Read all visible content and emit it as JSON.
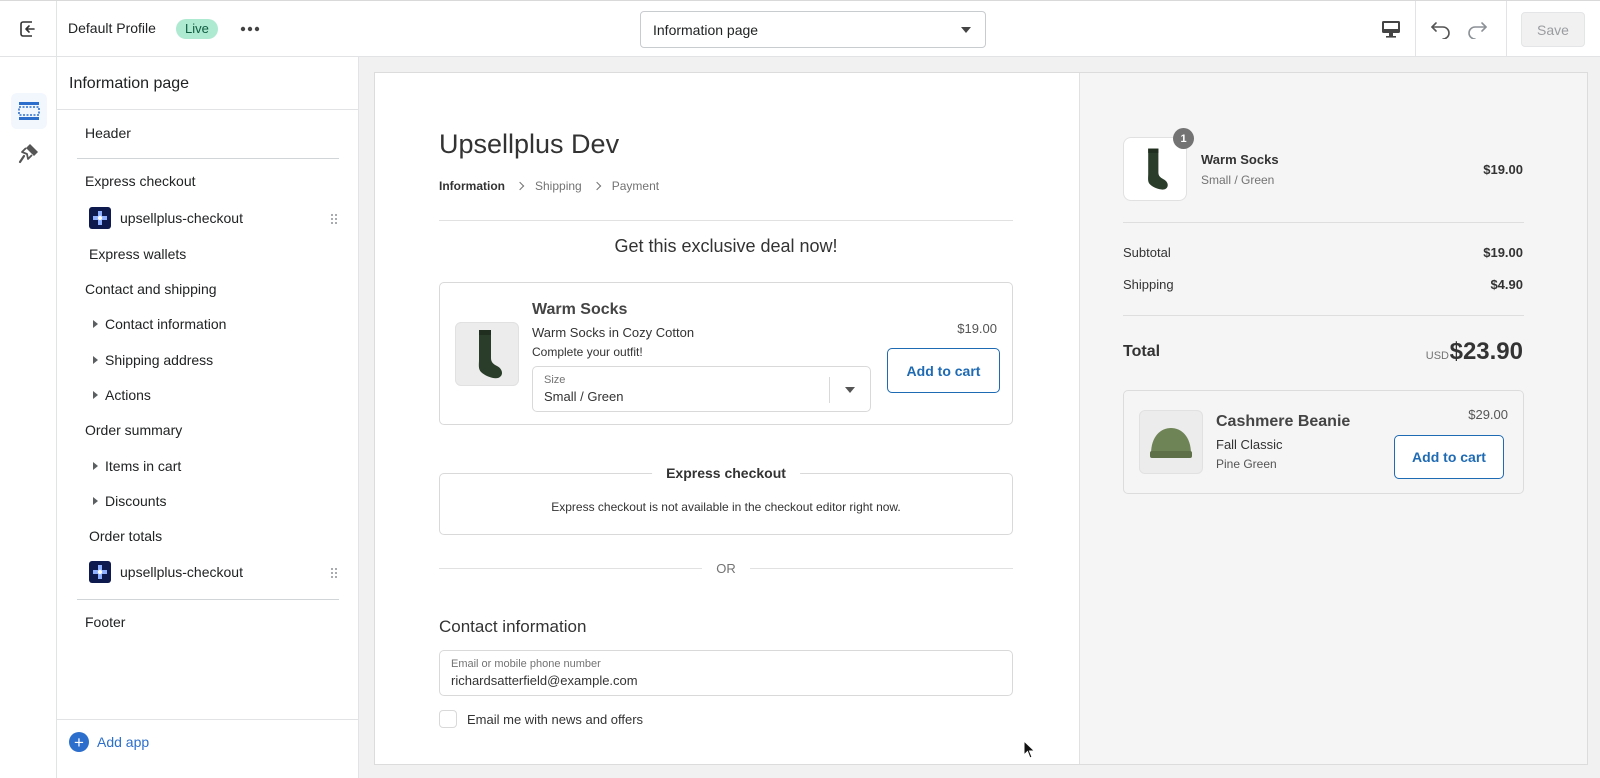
{
  "topbar": {
    "profile_name": "Default Profile",
    "status_badge": "Live",
    "page_select_value": "Information page",
    "save_label": "Save",
    "icons": [
      "exit-icon",
      "more-icon",
      "desktop-icon",
      "undo-icon",
      "redo-icon"
    ]
  },
  "rail": {
    "icons": [
      "sections-icon",
      "theme-brush-icon"
    ],
    "active": "sections-icon"
  },
  "sidebar": {
    "title": "Information page",
    "header": "Header",
    "express_checkout": {
      "label": "Express checkout",
      "app": "upsellplus-checkout",
      "wallets": "Express wallets"
    },
    "contact_shipping": {
      "label": "Contact and shipping",
      "items": [
        "Contact information",
        "Shipping address",
        "Actions"
      ]
    },
    "order_summary": {
      "label": "Order summary",
      "items": [
        "Items in cart",
        "Discounts"
      ],
      "totals": "Order totals",
      "app": "upsellplus-checkout"
    },
    "footer": "Footer",
    "add_app": "Add app"
  },
  "checkout": {
    "shop_name": "Upsellplus Dev",
    "breadcrumbs": [
      "Information",
      "Shipping",
      "Payment"
    ],
    "deal_heading": "Get this exclusive deal now!",
    "upsell": {
      "name": "Warm Socks",
      "description": "Warm Socks in Cozy Cotton",
      "note": "Complete your outfit!",
      "price": "$19.00",
      "size_label": "Size",
      "size_value": "Small / Green",
      "button": "Add to cart"
    },
    "express": {
      "title": "Express checkout",
      "message": "Express checkout is not available in the checkout editor right now."
    },
    "or_text": "OR",
    "contact_heading": "Contact information",
    "email_label": "Email or mobile phone number",
    "email_value": "richardsatterfield@example.com",
    "newsletter_label": "Email me with news and offers"
  },
  "summary": {
    "item": {
      "quantity": "1",
      "name": "Warm Socks",
      "variant": "Small / Green",
      "price": "$19.00"
    },
    "subtotal_label": "Subtotal",
    "subtotal": "$19.00",
    "shipping_label": "Shipping",
    "shipping": "$4.90",
    "total_label": "Total",
    "currency": "USD",
    "total": "$23.90",
    "upsell": {
      "name": "Cashmere Beanie",
      "line1": "Fall Classic",
      "line2": "Pine Green",
      "price": "$29.00",
      "button": "Add to cart"
    }
  },
  "colors": {
    "accent": "#1e6ab3",
    "live_badge_bg": "#aee9d1",
    "add_app_blue": "#2c6ecb",
    "sock_green": "#2a3d2a",
    "beanie_green": "#6f8456"
  }
}
